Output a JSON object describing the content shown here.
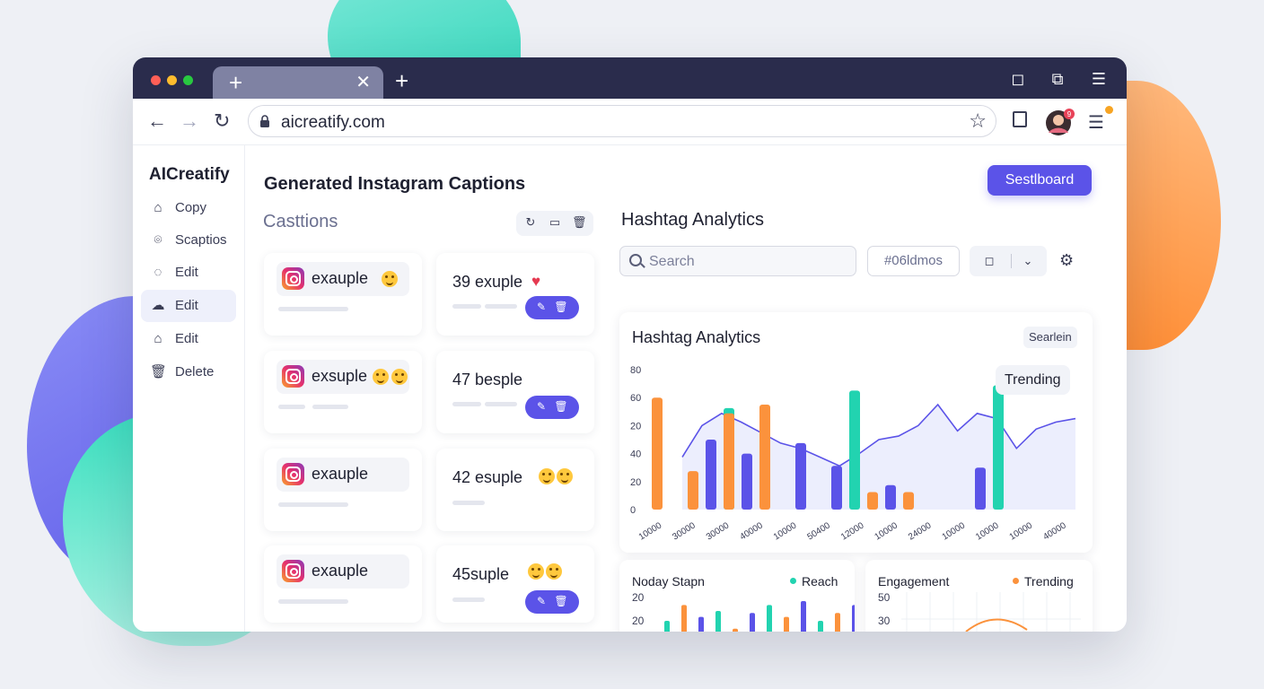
{
  "colors": {
    "primary": "#5b53e8",
    "teal": "#22d3b0",
    "orange": "#fb923c",
    "purple": "#5b53e8",
    "titlebar": "#2a2c4c"
  },
  "browser": {
    "url": "aicreatify.com",
    "tab_icon": "plus-icon",
    "controls": [
      "back-arrow-icon",
      "forward-arrow-icon",
      "reload-icon",
      "lock-icon",
      "star-icon",
      "bag-icon",
      "avatar",
      "menu-icon"
    ],
    "avatar_badge": "9"
  },
  "sidebar": {
    "brand": "AICreatify",
    "items": [
      {
        "label": "Copy",
        "icon": "home-icon"
      },
      {
        "label": "Scaptios",
        "icon": "captions-icon"
      },
      {
        "label": "Edit",
        "icon": "chat-icon"
      },
      {
        "label": "Edit",
        "icon": "cloud-icon",
        "active": true
      },
      {
        "label": "Edit",
        "icon": "edit-icon"
      },
      {
        "label": "Delete",
        "icon": "trash-icon"
      }
    ]
  },
  "main": {
    "title": "Generated Instagram Captions",
    "section_title": "Casttions",
    "left_cards": [
      "exauple",
      "exsuple",
      "exauple",
      "exauple"
    ],
    "right_cards": [
      "39 exuple",
      "47 besple",
      "42 esuple",
      "45suple"
    ]
  },
  "dashboard_button": "Sestlboard",
  "analytics": {
    "title": "Hashtag Analytics",
    "search_placeholder": "Search",
    "id_field": "#06ldmos",
    "card_title": "Hashtag Analytics",
    "card_chip": "Searlein",
    "trend_chip": "Trending"
  },
  "chart_data": [
    {
      "type": "bar",
      "title": "Hashtag Analytics",
      "y_ticks": [
        "80",
        "60",
        "20",
        "40",
        "20",
        "0"
      ],
      "x_ticks": [
        "10000",
        "30000",
        "30000",
        "40000",
        "10000",
        "50400",
        "12000",
        "10000",
        "24000",
        "10000",
        "10000",
        "10000",
        "40000"
      ],
      "series": [
        {
          "name": "orange",
          "values": [
            64,
            22,
            55,
            60,
            0,
            0,
            10,
            10,
            0,
            0
          ]
        },
        {
          "name": "purple",
          "values": [
            0,
            40,
            32,
            0,
            38,
            25,
            14,
            0,
            0,
            24
          ]
        },
        {
          "name": "teal",
          "values": [
            0,
            58,
            0,
            0,
            0,
            68,
            0,
            0,
            0,
            71
          ]
        }
      ],
      "line": [
        30,
        48,
        55,
        50,
        44,
        38,
        35,
        30,
        25,
        32,
        40,
        42,
        48,
        60,
        45,
        55,
        52,
        35,
        46,
        50,
        52
      ]
    },
    {
      "type": "bar",
      "title": "Noday Stapn",
      "legend": "Reach",
      "y_ticks": [
        "20",
        "20"
      ],
      "values": [
        10,
        18,
        12,
        15,
        6,
        14,
        18,
        12,
        20,
        10,
        14,
        18
      ]
    },
    {
      "type": "line",
      "title": "Engagement",
      "legend": "Trending",
      "y_ticks": [
        "50",
        "30"
      ]
    }
  ]
}
